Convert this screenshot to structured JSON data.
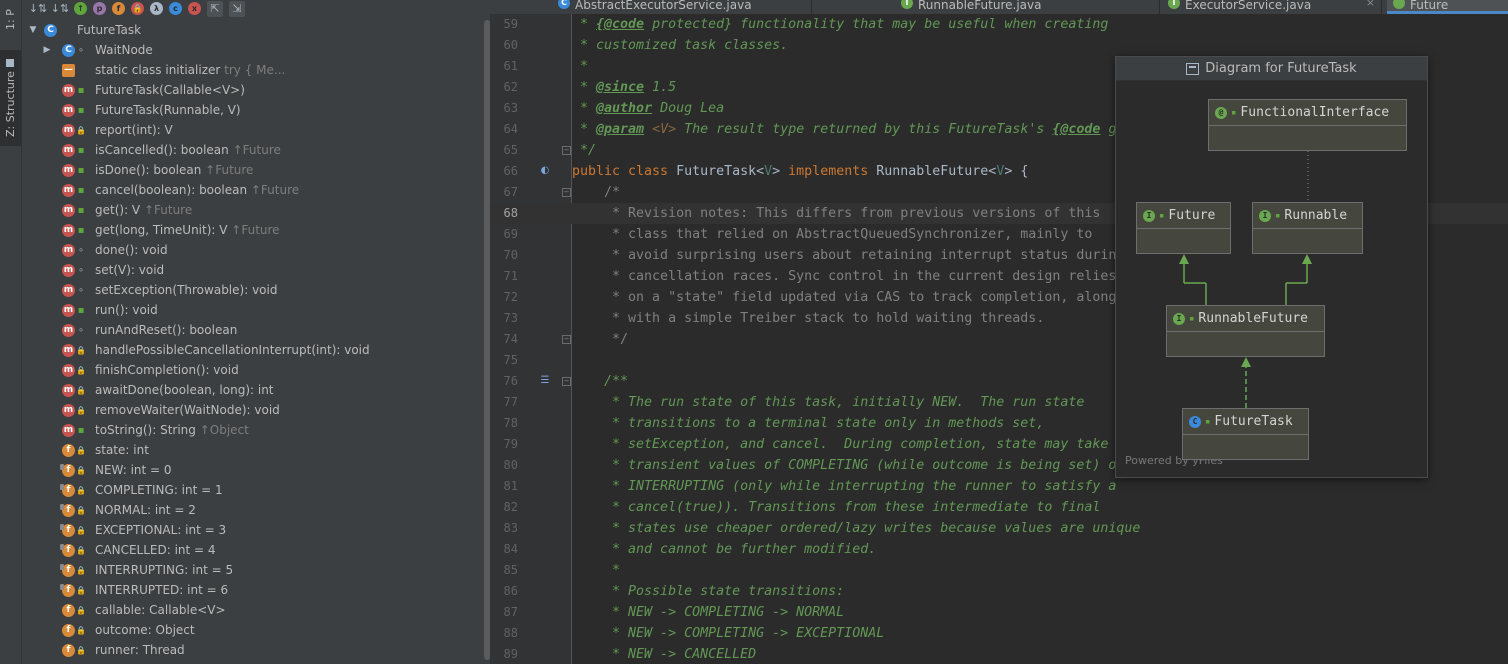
{
  "side_tabs": {
    "project": "1: P",
    "structure": "Z: Structure"
  },
  "struct_toolbar": [
    "sort-by-visibility-icon",
    "sort-alphabetically-icon",
    "show-inherited-icon",
    "show-properties-icon",
    "show-fields-icon",
    "show-non-public-icon",
    "show-lambdas-icon",
    "show-anonymous-icon",
    "hide-members-icon",
    "autoscroll-to-source-icon",
    "autoscroll-from-source-icon"
  ],
  "tree": [
    {
      "text": "FutureTask",
      "kind": "class",
      "vis": "",
      "indent": 0,
      "expander": "down"
    },
    {
      "text": "WaitNode",
      "kind": "class",
      "vis": "package",
      "indent": 1,
      "expander": "right"
    },
    {
      "text": "static class initializer",
      "dim": "try {             Me...",
      "kind": "static",
      "vis": "",
      "indent": 1
    },
    {
      "text": "FutureTask(Callable<V>)",
      "kind": "m",
      "vis": "public",
      "indent": 1
    },
    {
      "text": "FutureTask(Runnable, V)",
      "kind": "m",
      "vis": "public",
      "indent": 1
    },
    {
      "text": "report(int): V",
      "kind": "m",
      "vis": "private",
      "indent": 1
    },
    {
      "text": "isCancelled(): boolean",
      "dim": "↑Future",
      "kind": "m",
      "vis": "public",
      "indent": 1
    },
    {
      "text": "isDone(): boolean",
      "dim": "↑Future",
      "kind": "m",
      "vis": "public",
      "indent": 1
    },
    {
      "text": "cancel(boolean): boolean",
      "dim": "↑Future",
      "kind": "m",
      "vis": "public",
      "indent": 1
    },
    {
      "text": "get(): V",
      "dim": "↑Future",
      "kind": "m",
      "vis": "public",
      "indent": 1
    },
    {
      "text": "get(long, TimeUnit): V",
      "dim": "↑Future",
      "kind": "m",
      "vis": "public",
      "indent": 1
    },
    {
      "text": "done(): void",
      "kind": "m",
      "vis": "package",
      "indent": 1
    },
    {
      "text": "set(V): void",
      "kind": "m",
      "vis": "package",
      "indent": 1
    },
    {
      "text": "setException(Throwable): void",
      "kind": "m",
      "vis": "package",
      "indent": 1
    },
    {
      "text": "run(): void",
      "kind": "m",
      "vis": "public",
      "indent": 1
    },
    {
      "text": "runAndReset(): boolean",
      "kind": "m",
      "vis": "package",
      "indent": 1
    },
    {
      "text": "handlePossibleCancellationInterrupt(int): void",
      "kind": "m",
      "vis": "private",
      "indent": 1
    },
    {
      "text": "finishCompletion(): void",
      "kind": "m",
      "vis": "private",
      "indent": 1
    },
    {
      "text": "awaitDone(boolean, long): int",
      "kind": "m",
      "vis": "private",
      "indent": 1
    },
    {
      "text": "removeWaiter(WaitNode): void",
      "kind": "m",
      "vis": "private",
      "indent": 1
    },
    {
      "text": "toString(): String",
      "dim": "↑Object",
      "kind": "m",
      "vis": "public",
      "indent": 1
    },
    {
      "text": "state: int",
      "kind": "f",
      "vis": "private",
      "indent": 1
    },
    {
      "text": "NEW: int = 0",
      "kind": "fs",
      "vis": "private",
      "indent": 1
    },
    {
      "text": "COMPLETING: int = 1",
      "kind": "fs",
      "vis": "private",
      "indent": 1
    },
    {
      "text": "NORMAL: int = 2",
      "kind": "fs",
      "vis": "private",
      "indent": 1
    },
    {
      "text": "EXCEPTIONAL: int = 3",
      "kind": "fs",
      "vis": "private",
      "indent": 1
    },
    {
      "text": "CANCELLED: int = 4",
      "kind": "fs",
      "vis": "private",
      "indent": 1
    },
    {
      "text": "INTERRUPTING: int = 5",
      "kind": "fs",
      "vis": "private",
      "indent": 1
    },
    {
      "text": "INTERRUPTED: int = 6",
      "kind": "fs",
      "vis": "private",
      "indent": 1
    },
    {
      "text": "callable: Callable<V>",
      "kind": "f",
      "vis": "private",
      "indent": 1
    },
    {
      "text": "outcome: Object",
      "kind": "f",
      "vis": "private",
      "indent": 1
    },
    {
      "text": "runner: Thread",
      "kind": "f",
      "vis": "private",
      "indent": 1
    }
  ],
  "tabs": [
    {
      "label": "AbstractExecutorService.java",
      "icon": "C",
      "color": "#3a8ad9"
    },
    {
      "label": "RunnableFuture.java",
      "icon": "I",
      "color": "#6aa84f"
    },
    {
      "label": "ExecutorService.java",
      "icon": "I",
      "color": "#6aa84f"
    },
    {
      "label": "Future",
      "icon": "",
      "color": "#6aa84f"
    }
  ],
  "current_line": 68,
  "code_lines": [
    {
      "n": 59,
      "segs": [
        [
          "d",
          " * "
        ],
        [
          "t",
          "{@code"
        ],
        [
          "d",
          " protected} functionality that may be useful when creating"
        ]
      ]
    },
    {
      "n": 60,
      "segs": [
        [
          "d",
          " * customized task classes."
        ]
      ]
    },
    {
      "n": 61,
      "segs": [
        [
          "d",
          " *"
        ]
      ]
    },
    {
      "n": 62,
      "segs": [
        [
          "d",
          " * "
        ],
        [
          "t",
          "@since"
        ],
        [
          "d",
          " 1.5"
        ]
      ]
    },
    {
      "n": 63,
      "segs": [
        [
          "d",
          " * "
        ],
        [
          "t",
          "@author"
        ],
        [
          "d",
          " Doug Lea"
        ]
      ]
    },
    {
      "n": 64,
      "segs": [
        [
          "d",
          " * "
        ],
        [
          "t",
          "@param"
        ],
        [
          "d",
          " "
        ],
        [
          "v",
          "<V>"
        ],
        [
          "d",
          " The result type returned by this FutureTask's "
        ],
        [
          "t",
          "{@code"
        ],
        [
          "d",
          " g"
        ]
      ]
    },
    {
      "n": 65,
      "segs": [
        [
          "d",
          " */"
        ]
      ],
      "fold": "-"
    },
    {
      "n": 66,
      "segs": [
        [
          "k",
          "public class "
        ],
        [
          "p",
          "FutureTask<"
        ],
        [
          "g",
          "V"
        ],
        [
          "p",
          "> "
        ],
        [
          "k",
          "implements "
        ],
        [
          "p",
          "RunnableFuture<"
        ],
        [
          "g",
          "V"
        ],
        [
          "p",
          "> {"
        ]
      ],
      "gicon": "implemented-icon"
    },
    {
      "n": 67,
      "segs": [
        [
          "c",
          "    /*"
        ]
      ],
      "fold": "-"
    },
    {
      "n": 68,
      "segs": [
        [
          "c",
          "     * Revision notes: This differs from previous versions of this"
        ]
      ]
    },
    {
      "n": 69,
      "segs": [
        [
          "c",
          "     * class that relied on AbstractQueuedSynchronizer, mainly to"
        ]
      ]
    },
    {
      "n": 70,
      "segs": [
        [
          "c",
          "     * avoid surprising users about retaining interrupt status during"
        ]
      ]
    },
    {
      "n": 71,
      "segs": [
        [
          "c",
          "     * cancellation races. Sync control in the current design relies"
        ]
      ]
    },
    {
      "n": 72,
      "segs": [
        [
          "c",
          "     * on a \"state\" field updated via CAS to track completion, along"
        ]
      ]
    },
    {
      "n": 73,
      "segs": [
        [
          "c",
          "     * with a simple Treiber stack to hold waiting threads."
        ]
      ]
    },
    {
      "n": 74,
      "segs": [
        [
          "c",
          "     */"
        ]
      ],
      "fold": "-"
    },
    {
      "n": 75,
      "segs": [
        [
          "p",
          ""
        ]
      ]
    },
    {
      "n": 76,
      "segs": [
        [
          "d",
          "    /**"
        ]
      ],
      "fold": "-",
      "gicon": "rendered-doc-icon"
    },
    {
      "n": 77,
      "segs": [
        [
          "d",
          "     * The run state of this task, initially NEW.  The run state"
        ]
      ]
    },
    {
      "n": 78,
      "segs": [
        [
          "d",
          "     * transitions to a terminal state only in methods set,"
        ]
      ]
    },
    {
      "n": 79,
      "segs": [
        [
          "d",
          "     * setException, and cancel.  During completion, state may take"
        ]
      ]
    },
    {
      "n": 80,
      "segs": [
        [
          "d",
          "     * transient values of COMPLETING (while outcome is being set) or"
        ]
      ]
    },
    {
      "n": 81,
      "segs": [
        [
          "d",
          "     * INTERRUPTING (only while interrupting the runner to satisfy a"
        ]
      ]
    },
    {
      "n": 82,
      "segs": [
        [
          "d",
          "     * cancel(true)). Transitions from these intermediate to final"
        ]
      ]
    },
    {
      "n": 83,
      "segs": [
        [
          "d",
          "     * states use cheaper ordered/lazy writes because values are unique"
        ]
      ]
    },
    {
      "n": 84,
      "segs": [
        [
          "d",
          "     * and cannot be further modified."
        ]
      ]
    },
    {
      "n": 85,
      "segs": [
        [
          "d",
          "     *"
        ]
      ]
    },
    {
      "n": 86,
      "segs": [
        [
          "d",
          "     * Possible state transitions:"
        ]
      ]
    },
    {
      "n": 87,
      "segs": [
        [
          "d",
          "     * NEW -> COMPLETING -> NORMAL"
        ]
      ]
    },
    {
      "n": 88,
      "segs": [
        [
          "d",
          "     * NEW -> COMPLETING -> EXCEPTIONAL"
        ]
      ]
    },
    {
      "n": 89,
      "segs": [
        [
          "d",
          "     * NEW -> CANCELLED"
        ]
      ]
    }
  ],
  "diagram": {
    "title": "Diagram for FutureTask",
    "powered_by": "Powered by yFiles",
    "nodes": [
      {
        "id": "FunctionalInterface",
        "label": "FunctionalInterface",
        "icon": "@"
      },
      {
        "id": "Future",
        "label": "Future",
        "icon": "I"
      },
      {
        "id": "Runnable",
        "label": "Runnable",
        "icon": "I"
      },
      {
        "id": "RunnableFuture",
        "label": "RunnableFuture",
        "icon": "I"
      },
      {
        "id": "FutureTask",
        "label": "FutureTask",
        "icon": "C"
      }
    ]
  }
}
